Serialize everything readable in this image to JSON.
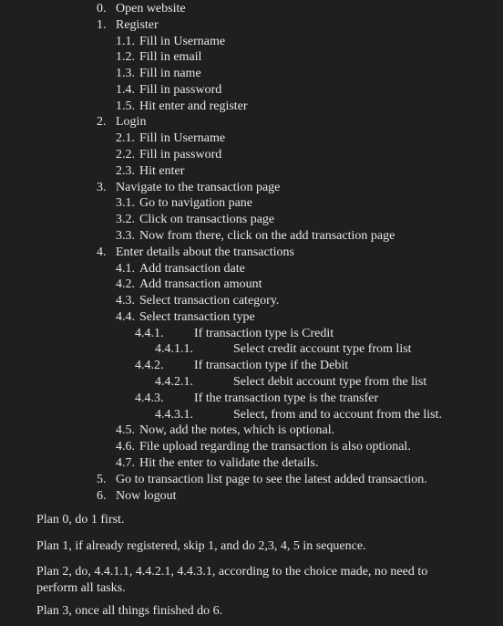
{
  "steps": [
    {
      "num": "0.",
      "text": "Open website"
    },
    {
      "num": "1.",
      "text": "Register"
    },
    {
      "num": "1.1.",
      "text": "Fill in Username"
    },
    {
      "num": "1.2.",
      "text": "Fill in email"
    },
    {
      "num": "1.3.",
      "text": "Fill in name"
    },
    {
      "num": "1.4.",
      "text": "Fill in password"
    },
    {
      "num": "1.5.",
      "text": "Hit enter and register"
    },
    {
      "num": "2.",
      "text": "Login"
    },
    {
      "num": "2.1.",
      "text": "Fill in Username"
    },
    {
      "num": "2.2.",
      "text": "Fill in password"
    },
    {
      "num": "2.3.",
      "text": "Hit enter"
    },
    {
      "num": "3.",
      "text": "Navigate to the transaction page"
    },
    {
      "num": "3.1.",
      "text": "Go to navigation pane"
    },
    {
      "num": "3.2.",
      "text": "Click on transactions page"
    },
    {
      "num": "3.3.",
      "text": "Now from there, click on the add transaction page"
    },
    {
      "num": "4.",
      "text": "Enter details about the transactions"
    },
    {
      "num": "4.1.",
      "text": "Add transaction date"
    },
    {
      "num": "4.2.",
      "text": "Add transaction amount"
    },
    {
      "num": "4.3.",
      "text": "Select transaction category."
    },
    {
      "num": "4.4.",
      "text": "Select transaction type"
    },
    {
      "num": "4.4.1.",
      "text": "If transaction type is Credit"
    },
    {
      "num": "4.4.1.1.",
      "text": "Select credit account type from list"
    },
    {
      "num": "4.4.2.",
      "text": "If transaction type if the Debit"
    },
    {
      "num": "4.4.2.1.",
      "text": "Select debit account type from the list"
    },
    {
      "num": "4.4.3.",
      "text": "If the transaction type is the transfer"
    },
    {
      "num": "4.4.3.1.",
      "text": "Select, from and to account from the list."
    },
    {
      "num": "4.5.",
      "text": "Now, add the notes, which is optional."
    },
    {
      "num": "4.6.",
      "text": "File upload regarding the transaction is also optional."
    },
    {
      "num": "4.7.",
      "text": "Hit the enter to validate the details."
    },
    {
      "num": "5.",
      "text": "Go to transaction list page to see the latest added transaction."
    },
    {
      "num": "6.",
      "text": "Now logout"
    }
  ],
  "plans": [
    "Plan 0, do 1 first.",
    "Plan 1, if already registered, skip 1, and do 2,3, 4, 5 in sequence.",
    "Plan 2, do, 4.4.1.1, 4.4.2.1, 4.4.3.1, according to the choice made, no need to perform all tasks.",
    "Plan 3, once all things finished do 6."
  ]
}
